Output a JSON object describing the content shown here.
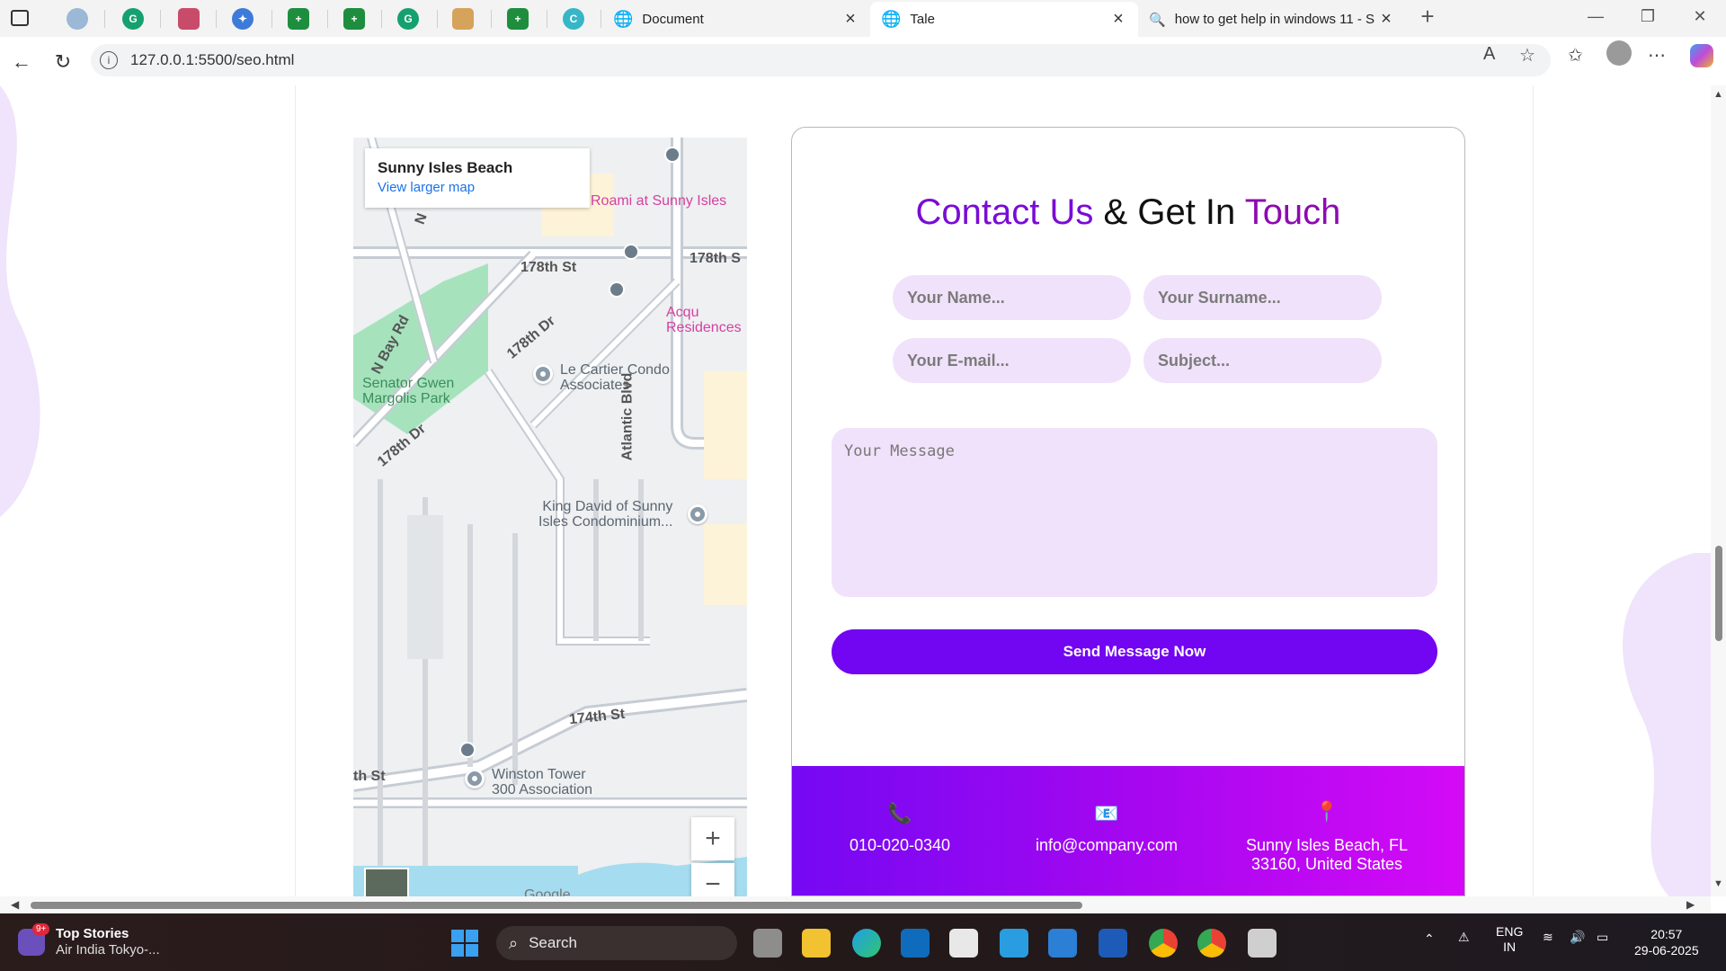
{
  "browser": {
    "pinned_tabs": [
      {
        "icon": "sidebar-toggle-icon",
        "color": "#333333"
      },
      {
        "icon": "moon-app-icon",
        "color": "#9bb8d6"
      },
      {
        "icon": "grammarly-icon",
        "color": "#15a070"
      },
      {
        "icon": "notes-app-icon",
        "color": "#c94b6a"
      },
      {
        "icon": "compass-app-icon",
        "color": "#3c7bd9"
      },
      {
        "icon": "sheets-icon",
        "color": "#1e8e3e"
      },
      {
        "icon": "sheets-icon",
        "color": "#1e8e3e"
      },
      {
        "icon": "grammarly-icon",
        "color": "#15a070"
      },
      {
        "icon": "document-app-icon",
        "color": "#d6a35b"
      },
      {
        "icon": "sheets-icon",
        "color": "#1e8e3e"
      },
      {
        "icon": "canva-icon",
        "color": "#36b6c7"
      }
    ],
    "tabs": [
      {
        "title": "Document",
        "active": false
      },
      {
        "title": "Tale",
        "active": true
      },
      {
        "title": "how to get help in windows 11 - S",
        "active": false
      }
    ],
    "new_tab_label": "+",
    "url": "127.0.0.1:5500/seo.html"
  },
  "map": {
    "place_name": "Sunny Isles Beach",
    "view_larger": "View larger map",
    "labels": {
      "roami": "Roami at Sunny Isles",
      "acqu": "Acqu\nResidences",
      "street_178_top": "178th St",
      "street_178_right": "178th S",
      "street_178_dr": "178th Dr",
      "street_178_dr2": "178th Dr",
      "n_bay_rd": "N Bay Rd",
      "n_letter": "N",
      "senator_park": "Senator Gwen\nMargolis Park",
      "le_cartier": "Le Cartier Condo\nAssociates",
      "atlantic_blvd": "Atlantic Blvd",
      "king_david": "King David of Sunny\nIsles Condominium...",
      "street_174": "174th St",
      "th_st": "th St",
      "winston": "Winston Tower\n300 Association",
      "google": "Google"
    },
    "zoom_in": "+",
    "zoom_out": "−"
  },
  "contact": {
    "title_part1": "Contact Us",
    "title_part2": "&",
    "title_part3": "Get In",
    "title_part4": "Touch",
    "name_placeholder": "Your Name...",
    "surname_placeholder": "Your Surname...",
    "email_placeholder": "Your E-mail...",
    "subject_placeholder": "Subject...",
    "message_placeholder": "Your Message",
    "send_label": "Send Message Now",
    "phone": "010-020-0340",
    "email": "info@company.com",
    "address_line1": "Sunny Isles Beach, FL",
    "address_line2": "33160, United States",
    "colors": {
      "accent": "#7205f2",
      "field_bg": "#f1e2fb"
    }
  },
  "taskbar": {
    "news_badge": "9+",
    "news_title": "Top Stories",
    "news_subtitle": "Air India Tokyo-...",
    "search_label": "Search",
    "language_line1": "ENG",
    "language_line2": "IN",
    "time": "20:57",
    "date": "29-06-2025"
  }
}
